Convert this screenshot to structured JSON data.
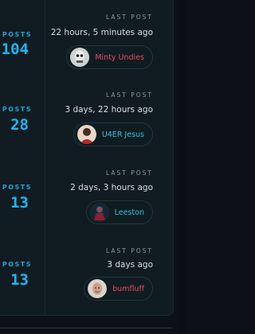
{
  "rows": [
    {
      "posts_label": "POSTS",
      "posts_value": "104",
      "last_post_label": "LAST POST",
      "time": "22 hours, 5 minutes ago",
      "user": {
        "name": "Minty Undies",
        "color": "#e84a63",
        "avatar": "skull-avatar"
      }
    },
    {
      "posts_label": "POSTS",
      "posts_value": "28",
      "last_post_label": "LAST POST",
      "time": "3 days, 22 hours ago",
      "user": {
        "name": "U4ER Jesus",
        "color": "#2ec4d9",
        "avatar": "red-figure-avatar"
      }
    },
    {
      "posts_label": "POSTS",
      "posts_value": "13",
      "last_post_label": "LAST POST",
      "time": "2 days, 3 hours ago",
      "user": {
        "name": "Leeston",
        "color": "#2ec4d9",
        "avatar": "armored-figure-avatar"
      }
    },
    {
      "posts_label": "POSTS",
      "posts_value": "13",
      "last_post_label": "LAST POST",
      "time": "3 days ago",
      "user": {
        "name": "bumfluff",
        "color": "#e84a63",
        "avatar": "face-avatar"
      }
    }
  ]
}
